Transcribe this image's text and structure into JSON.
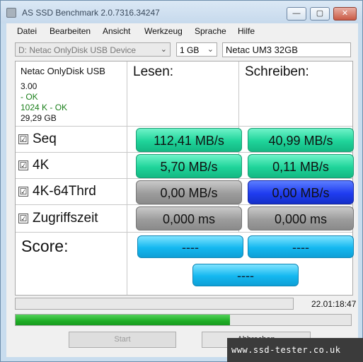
{
  "window": {
    "title": "AS SSD Benchmark 2.0.7316.34247",
    "minimize_glyph": "—",
    "maximize_glyph": "▢",
    "close_glyph": "✕"
  },
  "menu": [
    "Datei",
    "Bearbeiten",
    "Ansicht",
    "Werkzeug",
    "Sprache",
    "Hilfe"
  ],
  "toolbar": {
    "device": "D: Netac OnlyDisk USB Device",
    "size": "1 GB",
    "drive_name": "Netac UM3 32GB",
    "dropdown_glyph": "⌄"
  },
  "info": {
    "model": "Netac OnlyDisk USB",
    "firmware": "3.00",
    "driver_status": " - OK",
    "alignment": "1024 K - OK",
    "capacity": "29,29 GB"
  },
  "headers": {
    "read": "Lesen:",
    "write": "Schreiben:"
  },
  "checkbox_glyph": "☑",
  "rows": [
    {
      "label": "Seq",
      "read": "112,41 MB/s",
      "write": "40,99 MB/s"
    },
    {
      "label": "4K",
      "read": "5,70 MB/s",
      "write": "0,11 MB/s"
    },
    {
      "label": "4K-64Thrd",
      "read": "0,00 MB/s",
      "write": "0,00 MB/s"
    },
    {
      "label": "Zugriffszeit",
      "read": "0,000 ms",
      "write": "0,000 ms"
    }
  ],
  "score": {
    "label": "Score:",
    "read": "----",
    "write": "----",
    "total": "----"
  },
  "status": {
    "time": "22.01:18:47",
    "progress": 0.64
  },
  "buttons": {
    "start": "Start",
    "abort": "Abbrechen"
  },
  "watermark": "www.ssd-tester.co.uk",
  "colors": {
    "green": "#1fd49a",
    "gray": "#9c9c9c",
    "blue": "#1f3cf0",
    "cyan": "#14b8f0",
    "progress": "#1fae26"
  }
}
